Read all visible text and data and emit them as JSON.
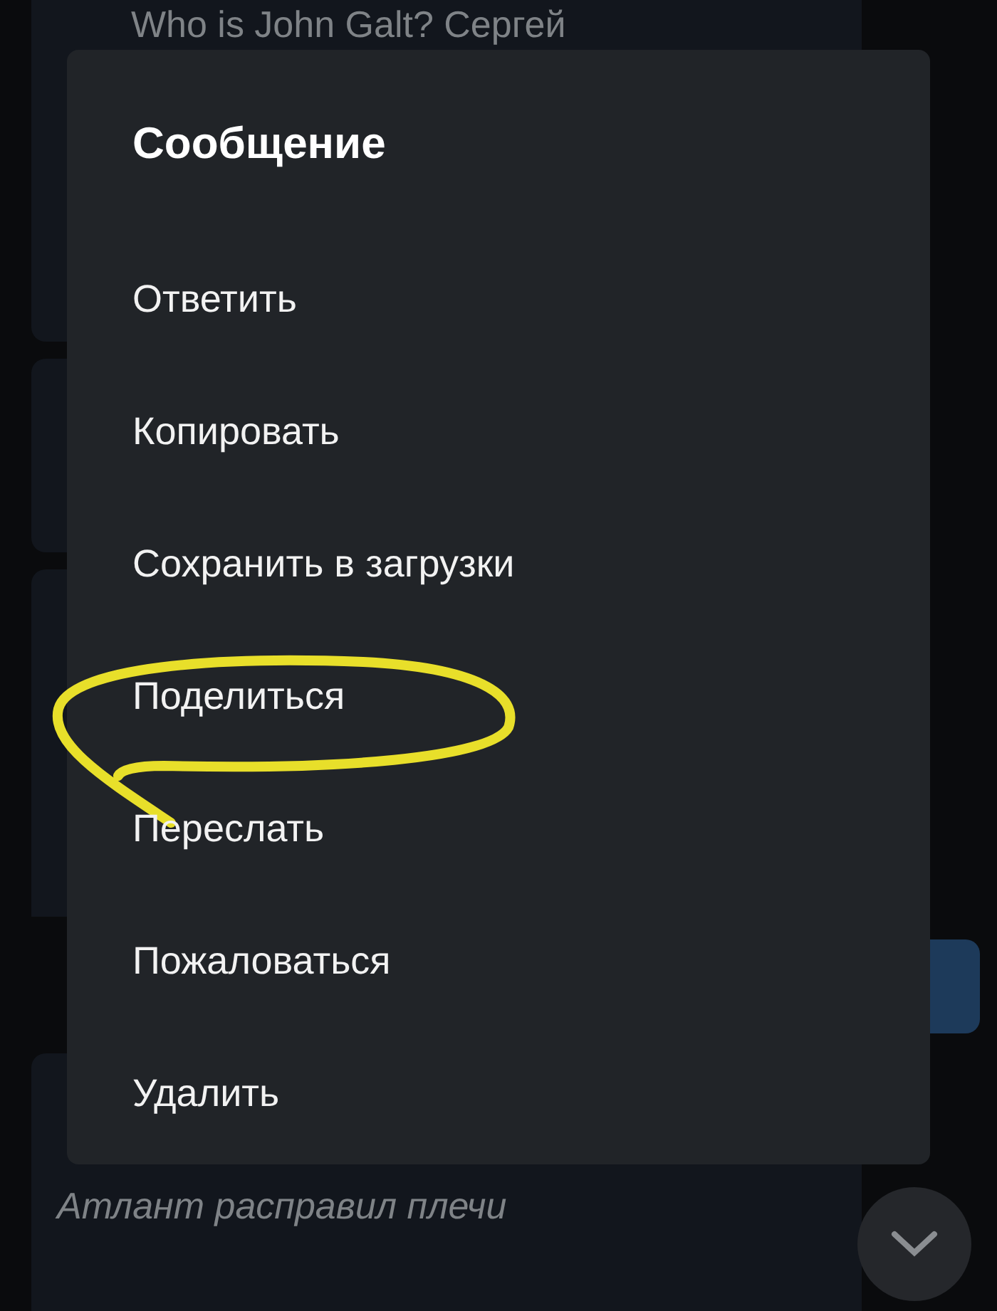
{
  "chat": {
    "messages": [
      {
        "kind": "incoming",
        "text": "Who is John Galt? Сергей"
      },
      {
        "kind": "incoming"
      },
      {
        "kind": "incoming"
      },
      {
        "kind": "outgoing"
      },
      {
        "kind": "incoming",
        "italic": true,
        "text": "Атлант расправил плечи"
      }
    ]
  },
  "dialog": {
    "title": "Сообщение",
    "items": [
      {
        "label": "Ответить",
        "highlighted": false
      },
      {
        "label": "Копировать",
        "highlighted": false
      },
      {
        "label": "Сохранить в загрузки",
        "highlighted": false
      },
      {
        "label": "Поделиться",
        "highlighted": true
      },
      {
        "label": "Переслать",
        "highlighted": false
      },
      {
        "label": "Пожаловаться",
        "highlighted": false
      },
      {
        "label": "Удалить",
        "highlighted": false
      }
    ]
  }
}
